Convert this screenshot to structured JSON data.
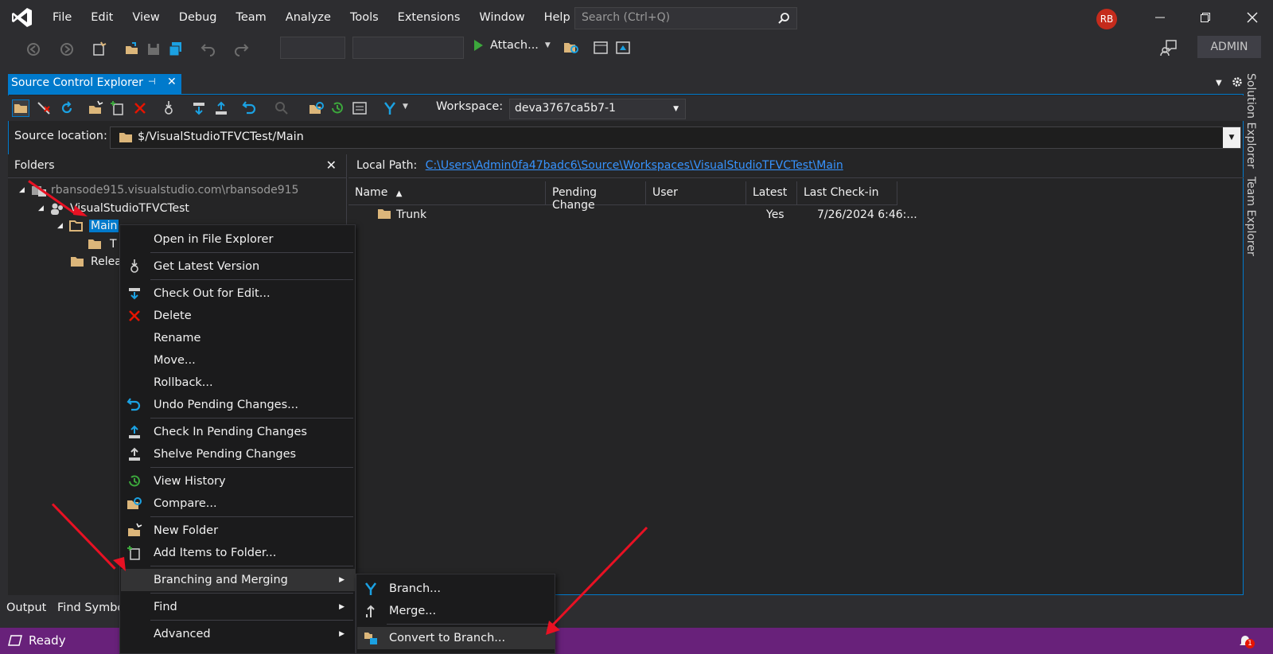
{
  "menubar": {
    "items": [
      "File",
      "Edit",
      "View",
      "Debug",
      "Team",
      "Analyze",
      "Tools",
      "Extensions",
      "Window",
      "Help"
    ],
    "search_placeholder": "Search (Ctrl+Q)",
    "avatar": "RB",
    "admin": "ADMIN"
  },
  "toolbar": {
    "attach_label": "Attach..."
  },
  "tab": {
    "title": "Source Control Explorer",
    "pin": "⊣",
    "close": "✕"
  },
  "sc_toolbar": {
    "workspace_label": "Workspace:",
    "workspace_value": "deva3767ca5b7-1"
  },
  "source_location": {
    "label": "Source location:",
    "value": "$/VisualStudioTFVCTest/Main"
  },
  "folders": {
    "title": "Folders",
    "close": "✕",
    "tree": {
      "root": "rbansode915.visualstudio.com\\rbansode915",
      "project": "VisualStudioTFVCTest",
      "main": "Main",
      "trunk": "T",
      "releases": "Relea"
    }
  },
  "right": {
    "local_path_label": "Local Path:",
    "local_path": "C:\\Users\\Admin0fa47badc6\\Source\\Workspaces\\VisualStudioTFVCTest\\Main",
    "columns": [
      "Name",
      "Pending Change",
      "User",
      "Latest",
      "Last Check-in"
    ],
    "rows": [
      {
        "name": "Trunk",
        "pending": "",
        "user": "",
        "latest": "Yes",
        "checkin": "7/26/2024 6:46:..."
      }
    ]
  },
  "context_menu": {
    "items": [
      {
        "label": "Open in File Explorer",
        "icon": "none"
      },
      {
        "label": "Get Latest Version",
        "icon": "get-latest-icon"
      },
      {
        "label": "Check Out for Edit...",
        "icon": "checkout-icon"
      },
      {
        "label": "Delete",
        "icon": "delete-icon"
      },
      {
        "label": "Rename",
        "icon": "none"
      },
      {
        "label": "Move...",
        "icon": "none"
      },
      {
        "label": "Rollback...",
        "icon": "none"
      },
      {
        "label": "Undo Pending Changes...",
        "icon": "undo-icon"
      },
      {
        "label": "Check In Pending Changes",
        "icon": "checkin-icon"
      },
      {
        "label": "Shelve Pending Changes",
        "icon": "shelve-icon"
      },
      {
        "label": "View History",
        "icon": "history-icon"
      },
      {
        "label": "Compare...",
        "icon": "compare-icon"
      },
      {
        "label": "New Folder",
        "icon": "new-folder-icon"
      },
      {
        "label": "Add Items to Folder...",
        "icon": "add-items-icon"
      },
      {
        "label": "Branching and Merging",
        "icon": "none"
      },
      {
        "label": "Find",
        "icon": "none"
      },
      {
        "label": "Advanced",
        "icon": "none"
      }
    ]
  },
  "submenu": {
    "items": [
      "Branch...",
      "Merge...",
      "Convert to Branch..."
    ]
  },
  "bottom_tabs": [
    "Output",
    "Find Symbo"
  ],
  "status": {
    "text": "Ready",
    "notifications": "1"
  },
  "side_tabs": [
    "Solution Explorer",
    "Team Explorer"
  ],
  "colors": {
    "accent": "#007acc",
    "status": "#68217a",
    "arrow": "#e81123"
  }
}
